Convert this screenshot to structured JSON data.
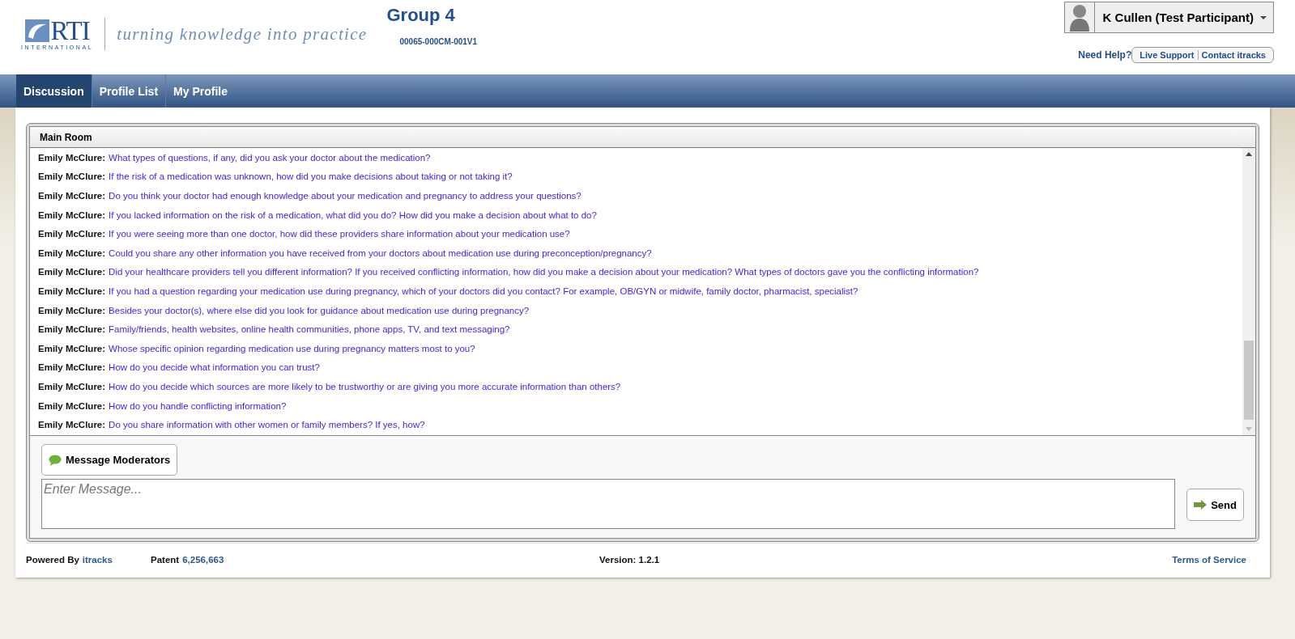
{
  "logo": {
    "name": "RTI",
    "sub": "INTERNATIONAL",
    "tagline": "turning knowledge into practice"
  },
  "group": {
    "title": "Group 4",
    "code": "00065-000CM-001V1"
  },
  "user": {
    "name": "K Cullen (Test Participant)"
  },
  "help": {
    "label": "Need Help?",
    "links": [
      "Live Support",
      "Contact itracks"
    ]
  },
  "nav": [
    {
      "label": "Discussion",
      "selected": true
    },
    {
      "label": "Profile List",
      "selected": false
    },
    {
      "label": "My Profile",
      "selected": false
    }
  ],
  "room": {
    "title": "Main Room"
  },
  "messages": [
    {
      "author": "Emily McClure:",
      "text": "What types of questions, if any, did you ask your doctor about the medication?"
    },
    {
      "author": "Emily McClure:",
      "text": "If the risk of a medication was unknown, how did you make decisions about taking or not taking it?"
    },
    {
      "author": "Emily McClure:",
      "text": "Do you think your doctor had enough knowledge about your medication and pregnancy to address your questions?"
    },
    {
      "author": "Emily McClure:",
      "text": "If you lacked information on the risk of a medication, what did you do? How did you make a decision about what to do?"
    },
    {
      "author": "Emily McClure:",
      "text": "If you were seeing more than one doctor, how did these providers share information about your medication use?"
    },
    {
      "author": "Emily McClure:",
      "text": "Could you share any other information you have received from your doctors about medication use during preconception/pregnancy?"
    },
    {
      "author": "Emily McClure:",
      "text": "Did your healthcare providers tell you different information? If you received conflicting information, how did you make a decision about your medication? What types of doctors gave you the conflicting information?"
    },
    {
      "author": "Emily McClure:",
      "text": "If you had a question regarding your medication use during pregnancy, which of your doctors did you contact? For example, OB/GYN or midwife, family doctor, pharmacist, specialist?"
    },
    {
      "author": "Emily McClure:",
      "text": "Besides your doctor(s), where else did you look for guidance about medication use during pregnancy?"
    },
    {
      "author": "Emily McClure:",
      "text": "Family/friends, health websites, online health communities, phone apps, TV, and text messaging?"
    },
    {
      "author": "Emily McClure:",
      "text": "Whose specific opinion regarding medication use during pregnancy matters most to you?"
    },
    {
      "author": "Emily McClure:",
      "text": "How do you decide what information you can trust?"
    },
    {
      "author": "Emily McClure:",
      "text": "How do you decide which sources are more likely to be trustworthy or are giving you more accurate information than others?"
    },
    {
      "author": "Emily McClure:",
      "text": "How do you handle conflicting information?"
    },
    {
      "author": "Emily McClure:",
      "text": "Do you share information with other women or family members? If yes, how?"
    }
  ],
  "moderators_button": "Message Moderators",
  "message_field": {
    "placeholder": "Enter Message..."
  },
  "send_button": "Send",
  "footer": {
    "powered_label": "Powered By",
    "powered_link": "itracks",
    "patent_label": "Patent",
    "patent_link": "6,256,663",
    "version": "Version: 1.2.1",
    "terms": "Terms of Service"
  }
}
